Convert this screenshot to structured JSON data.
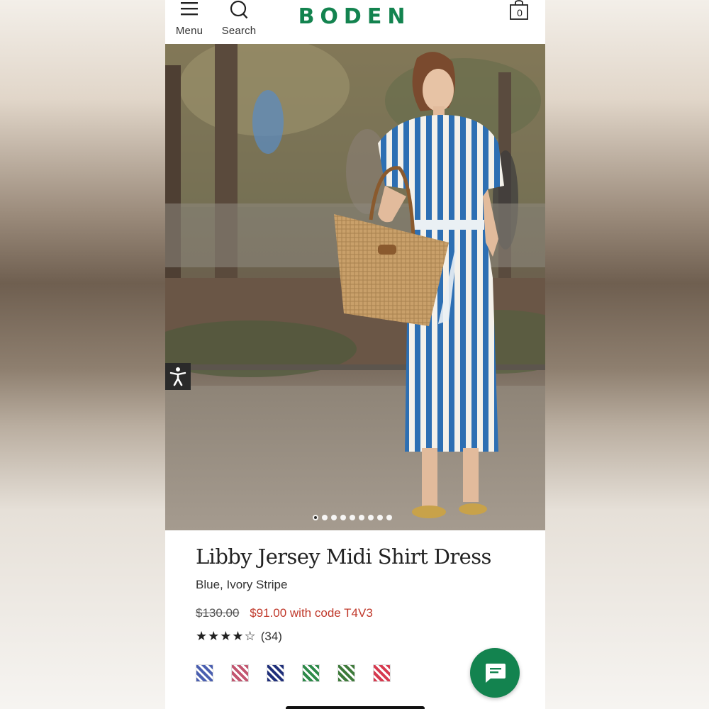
{
  "brand": {
    "name": "BODEN",
    "color": "#13834f"
  },
  "header": {
    "menu_label": "Menu",
    "search_label": "Search",
    "bag_count": "0"
  },
  "gallery": {
    "slide_count": 9,
    "active_slide": 1
  },
  "product": {
    "title": "Libby Jersey Midi Shirt Dress",
    "color": "Blue, Ivory Stripe",
    "price_original": "$130.00",
    "price_promo": "$91.00 with code T4V3",
    "rating_stars": "★★★★☆",
    "rating": 4.5,
    "review_count": "(34)",
    "swatches": [
      {
        "name": "blue-floral",
        "color": "#4a5fb0"
      },
      {
        "name": "pink-floral",
        "color": "#c25670"
      },
      {
        "name": "navy-check",
        "color": "#1f2f7a"
      },
      {
        "name": "green-ivory-stripe",
        "color": "#2e8a4a"
      },
      {
        "name": "green-spot",
        "color": "#3d7a3a"
      },
      {
        "name": "red-spot",
        "color": "#d63a4f"
      }
    ]
  },
  "icons": {
    "menu": "hamburger-icon",
    "search": "search-icon",
    "bag": "bag-icon",
    "accessibility": "accessibility-icon",
    "chat": "chat-icon"
  }
}
